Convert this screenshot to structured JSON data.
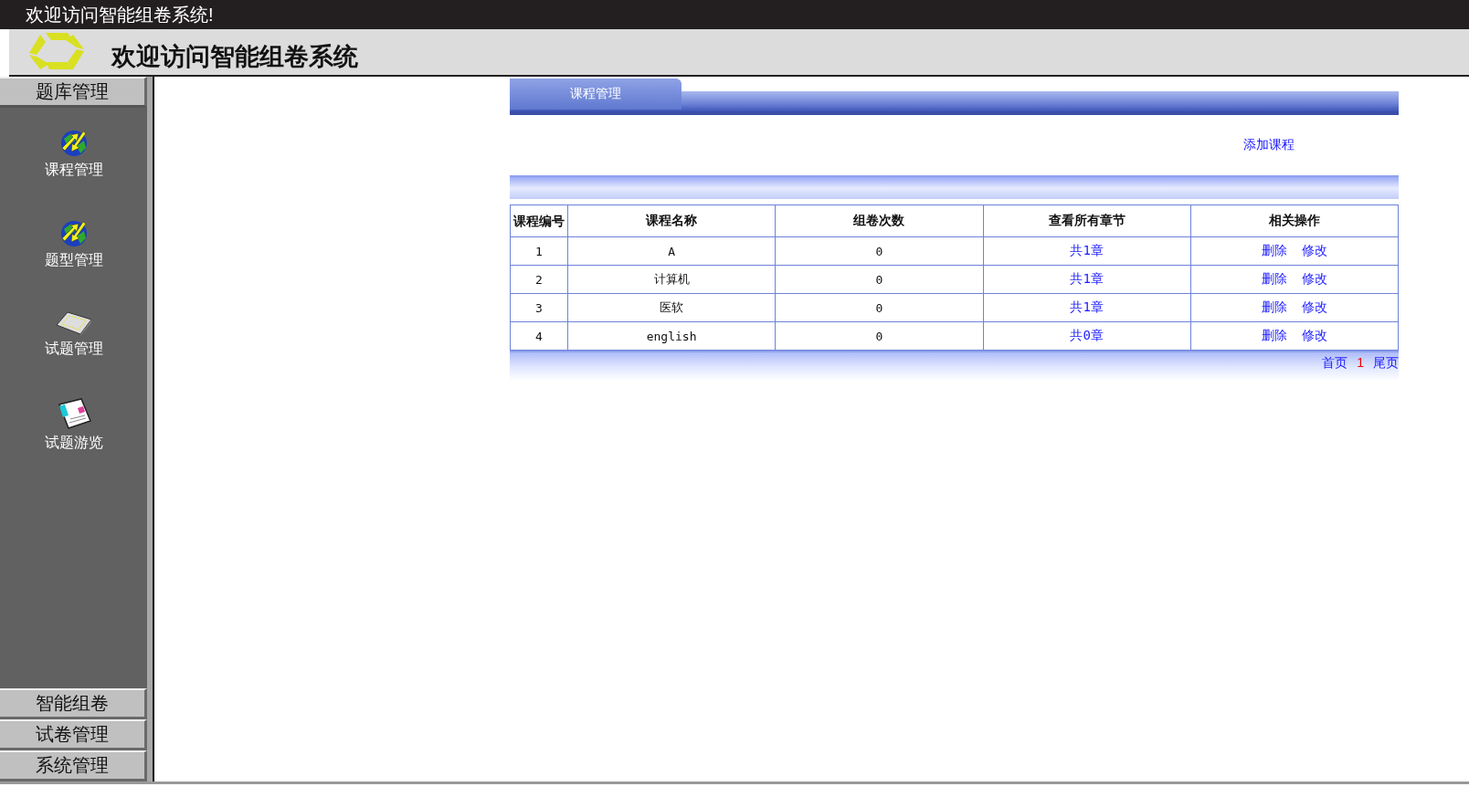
{
  "title_bar": {
    "title": "欢迎访问智能组卷系统!"
  },
  "header": {
    "title": "欢迎访问智能组卷系统"
  },
  "sidebar": {
    "groups": [
      {
        "label": "题库管理",
        "expanded": true,
        "items": [
          {
            "label": "课程管理",
            "kind": "globe"
          },
          {
            "label": "题型管理",
            "kind": "globe"
          },
          {
            "label": "试题管理",
            "kind": "keyboard"
          },
          {
            "label": "试题游览",
            "kind": "document"
          }
        ]
      },
      {
        "label": "智能组卷",
        "expanded": false
      },
      {
        "label": "试卷管理",
        "expanded": false
      },
      {
        "label": "系统管理",
        "expanded": false
      }
    ]
  },
  "panel": {
    "tab": "课程管理",
    "add_link": "添加课程",
    "table": {
      "columns": [
        "课程编号",
        "课程名称",
        "组卷次数",
        "查看所有章节",
        "相关操作"
      ],
      "rows": [
        {
          "id": "1",
          "name": "A",
          "count": "0",
          "chapters": "共1章",
          "delete": "删除",
          "edit": "修改"
        },
        {
          "id": "2",
          "name": "计算机",
          "count": "0",
          "chapters": "共1章",
          "delete": "删除",
          "edit": "修改"
        },
        {
          "id": "3",
          "name": "医软",
          "count": "0",
          "chapters": "共1章",
          "delete": "删除",
          "edit": "修改"
        },
        {
          "id": "4",
          "name": "english",
          "count": "0",
          "chapters": "共0章",
          "delete": "删除",
          "edit": "修改"
        }
      ]
    },
    "pager": {
      "first": "首页",
      "current": "1",
      "last": "尾页"
    }
  }
}
